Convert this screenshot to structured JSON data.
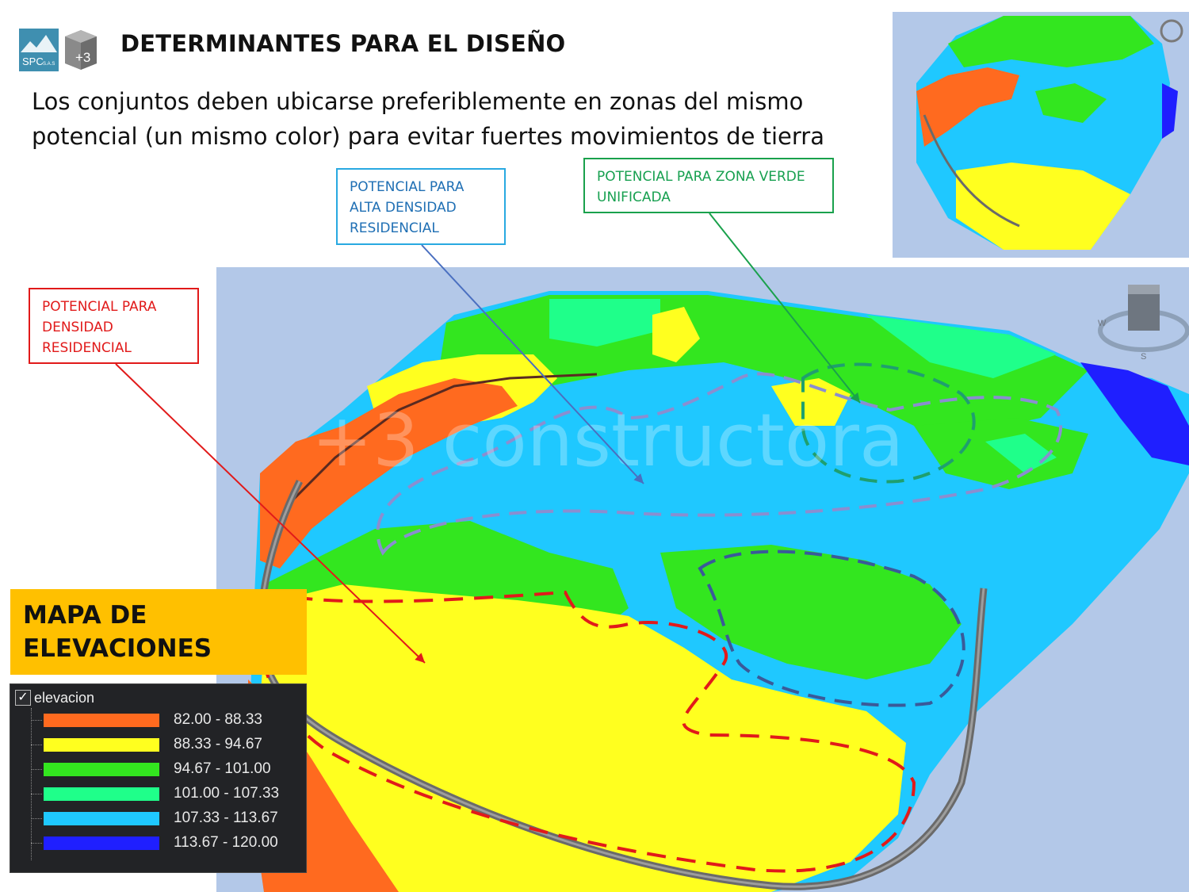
{
  "header": {
    "title": "DETERMINANTES PARA EL DISEÑO",
    "subtitle": "Los conjuntos  deben ubicarse preferiblemente en zonas del mismo potencial (un mismo color) para evitar fuertes movimientos de tierra"
  },
  "logo": {
    "spc": "SPC",
    "sas": "S.A.S",
    "plus3": "+3"
  },
  "watermark": "+3 constructora",
  "callouts": {
    "blue": {
      "text": "POTENCIAL PARA ALTA DENSIDAD RESIDENCIAL",
      "color": "#1f6fb4"
    },
    "green": {
      "text": "POTENCIAL PARA ZONA VERDE UNIFICADA",
      "color": "#17a050"
    },
    "red": {
      "text": "POTENCIAL PARA DENSIDAD RESIDENCIAL",
      "color": "#e11a1a"
    }
  },
  "compass": {
    "w": "W",
    "s": "S"
  },
  "map_title": "MAPA DE ELEVACIONES",
  "legend": {
    "layer": "elevacion",
    "items": [
      {
        "label": "82.00 - 88.33",
        "color": "#ff6a1f"
      },
      {
        "label": "88.33 - 94.67",
        "color": "#ffff1f"
      },
      {
        "label": "94.67 - 101.00",
        "color": "#33e61f"
      },
      {
        "label": "101.00 - 107.33",
        "color": "#1fff8a"
      },
      {
        "label": "107.33 - 113.67",
        "color": "#1fc8ff"
      },
      {
        "label": "113.67 - 120.00",
        "color": "#1f1fff"
      }
    ]
  }
}
